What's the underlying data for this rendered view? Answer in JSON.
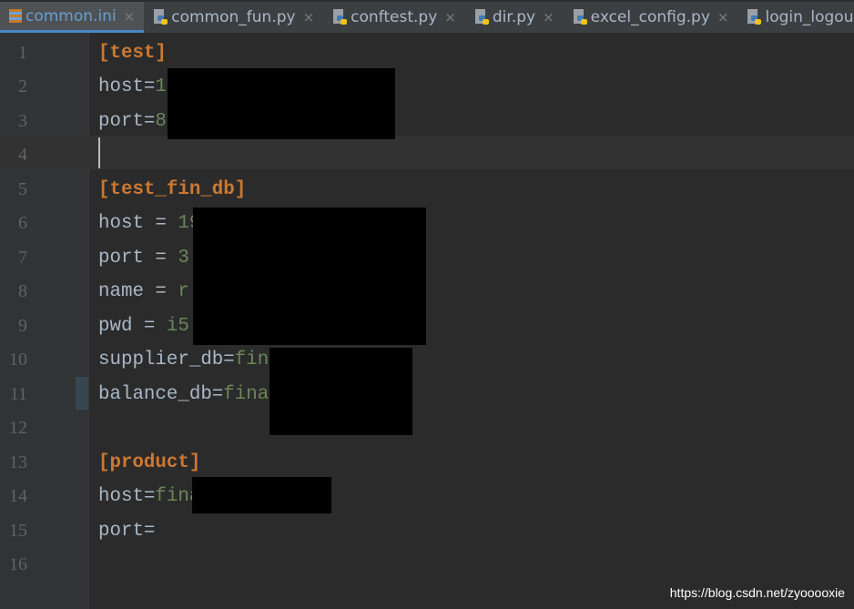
{
  "tabs": [
    {
      "label": "common.ini",
      "icon": "ini-file-icon",
      "active": true
    },
    {
      "label": "common_fun.py",
      "icon": "python-file-icon"
    },
    {
      "label": "conftest.py",
      "icon": "python-file-icon"
    },
    {
      "label": "dir.py",
      "icon": "python-file-icon"
    },
    {
      "label": "excel_config.py",
      "icon": "python-file-icon"
    },
    {
      "label": "login_logou",
      "icon": "python-file-icon"
    }
  ],
  "close_glyph": "×",
  "lines": [
    {
      "n": "1",
      "key": "",
      "val": "",
      "sec": "[test]"
    },
    {
      "n": "2",
      "key": "host=",
      "val": "1"
    },
    {
      "n": "3",
      "key": "port=",
      "val": "8"
    },
    {
      "n": "4",
      "key": "",
      "val": ""
    },
    {
      "n": "5",
      "key": "",
      "val": "",
      "sec": "[test_fin_db]"
    },
    {
      "n": "6",
      "key": "host = ",
      "val": "19"
    },
    {
      "n": "7",
      "key": "port = ",
      "val": "3"
    },
    {
      "n": "8",
      "key": "name = ",
      "val": "r"
    },
    {
      "n": "9",
      "key": "pwd = ",
      "val": "i5"
    },
    {
      "n": "10",
      "key": "supplier_db=",
      "val": "fin"
    },
    {
      "n": "11",
      "key": "balance_db=",
      "val": "fina"
    },
    {
      "n": "12",
      "key": "",
      "val": ""
    },
    {
      "n": "13",
      "key": "",
      "val": "",
      "sec": "[product]"
    },
    {
      "n": "14",
      "key": "host=",
      "val": "fina"
    },
    {
      "n": "15",
      "key": "port=",
      "val": ""
    },
    {
      "n": "16",
      "key": "",
      "val": ""
    }
  ],
  "current_line": "4",
  "watermark": "https://blog.csdn.net/zyooooxie",
  "colors": {
    "section": "#cc7832",
    "key": "#a9b7c6",
    "value": "#6a8759",
    "background": "#2b2b2b",
    "accent": "#4a88c7"
  }
}
